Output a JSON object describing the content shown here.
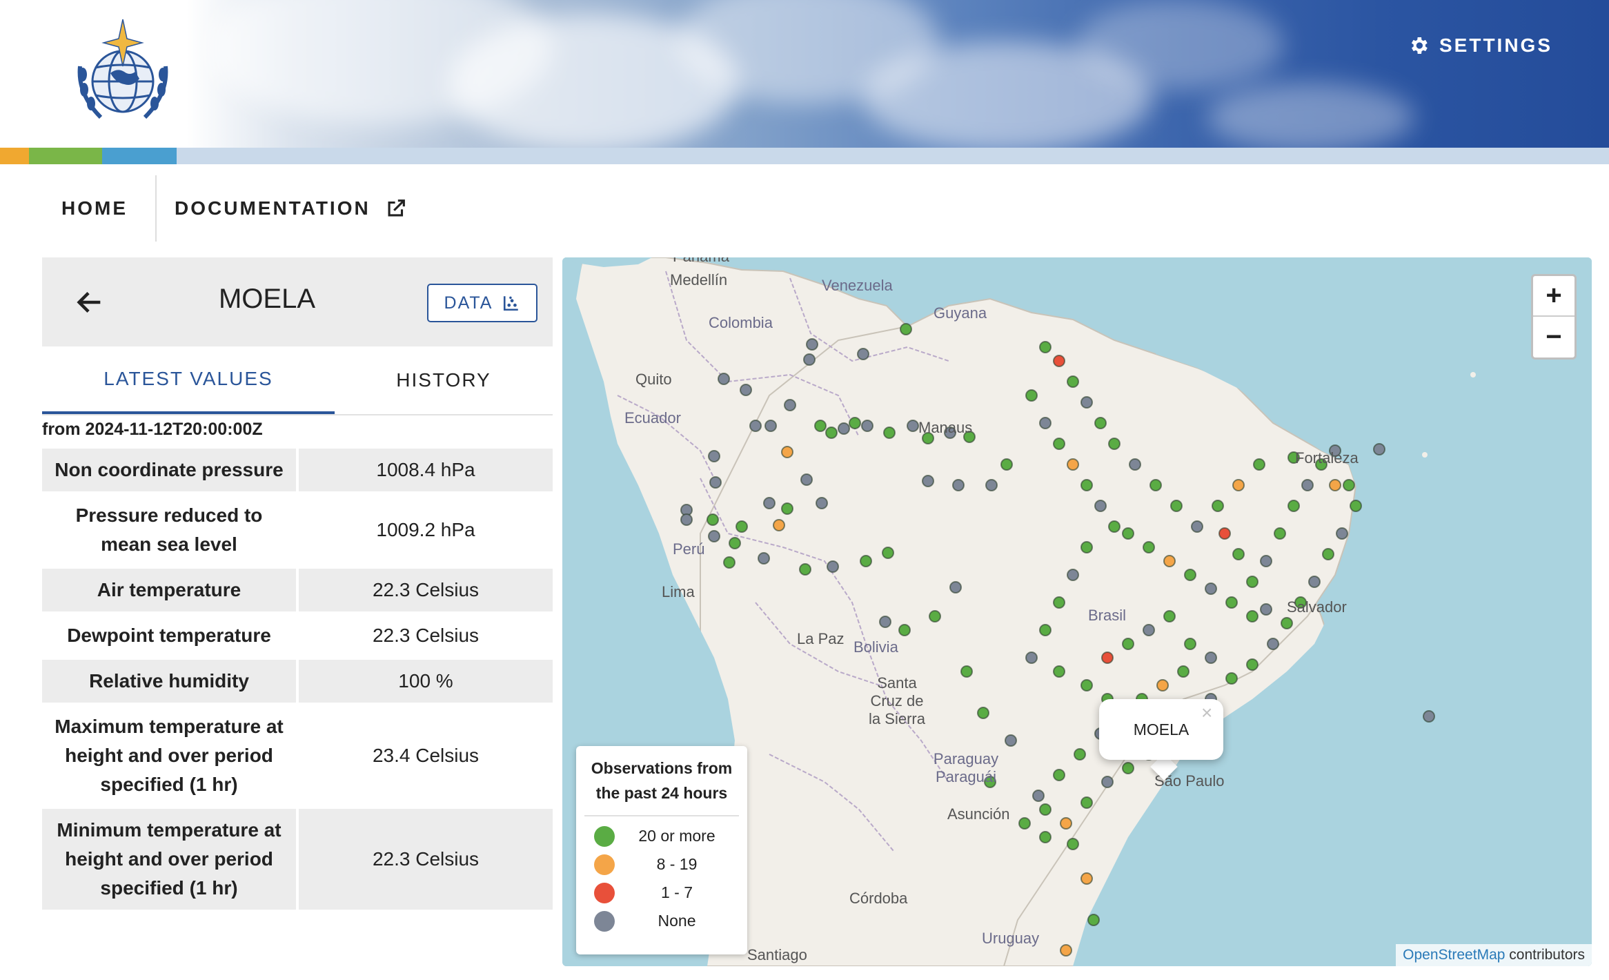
{
  "header": {
    "settings_label": "SETTINGS",
    "colors": {
      "sky_dark": "#244c9a",
      "orange": "#f0a830",
      "green": "#7ab648",
      "blue": "#4a9fd0"
    }
  },
  "nav": {
    "home": "HOME",
    "documentation": "DOCUMENTATION"
  },
  "station": {
    "name": "MOELA",
    "data_button": "DATA",
    "tabs": {
      "latest": "LATEST VALUES",
      "history": "HISTORY"
    },
    "from_label": "from 2024-11-12T20:00:00Z",
    "rows": [
      {
        "label": "Non coordinate pressure",
        "value": "1008.4 hPa"
      },
      {
        "label": "Pressure reduced to mean sea level",
        "value": "1009.2 hPa"
      },
      {
        "label": "Air temperature",
        "value": "22.3 Celsius"
      },
      {
        "label": "Dewpoint temperature",
        "value": "22.3 Celsius"
      },
      {
        "label": "Relative humidity",
        "value": "100 %"
      },
      {
        "label": "Maximum temperature at height and over period specified (1 hr)",
        "value": "23.4 Celsius"
      },
      {
        "label": "Minimum temperature at height and over period specified (1 hr)",
        "value": "22.3 Celsius"
      }
    ]
  },
  "map": {
    "labels": {
      "panama": "Panamá",
      "medellin": "Medellín",
      "venezuela": "Venezuela",
      "guyana": "Guyana",
      "colombia": "Colombia",
      "quito": "Quito",
      "ecuador": "Ecuador",
      "manaus": "Manaus",
      "fortaleza": "Fortaleza",
      "peru": "Perú",
      "lima": "Lima",
      "brasil": "Brasil",
      "salvador": "Salvador",
      "lapaz": "La Paz",
      "bolivia": "Bolivia",
      "santacruz": "Santa Cruz de la Sierra",
      "paraguay": "Paraguay Paraguái",
      "saopaulo": "São Paulo",
      "asuncion": "Asunción",
      "cordoba": "Córdoba",
      "uruguay": "Uruguay",
      "santiago": "Santiago"
    },
    "zoom_in": "+",
    "zoom_out": "−",
    "popup_label": "MOELA",
    "popup_close": "×",
    "attribution_link": "OpenStreetMap",
    "attribution_text": " contributors",
    "legend": {
      "title": "Observations from the past 24 hours",
      "items": [
        {
          "label": "20 or more",
          "color": "#5aac44"
        },
        {
          "label": "8 - 19",
          "color": "#f4a548"
        },
        {
          "label": "1 - 7",
          "color": "#e8503a"
        },
        {
          "label": "None",
          "color": "#7d8696"
        }
      ]
    },
    "colors": {
      "ocean": "#aad3df",
      "land": "#f2efe9",
      "border": "#b9a9c9"
    }
  }
}
